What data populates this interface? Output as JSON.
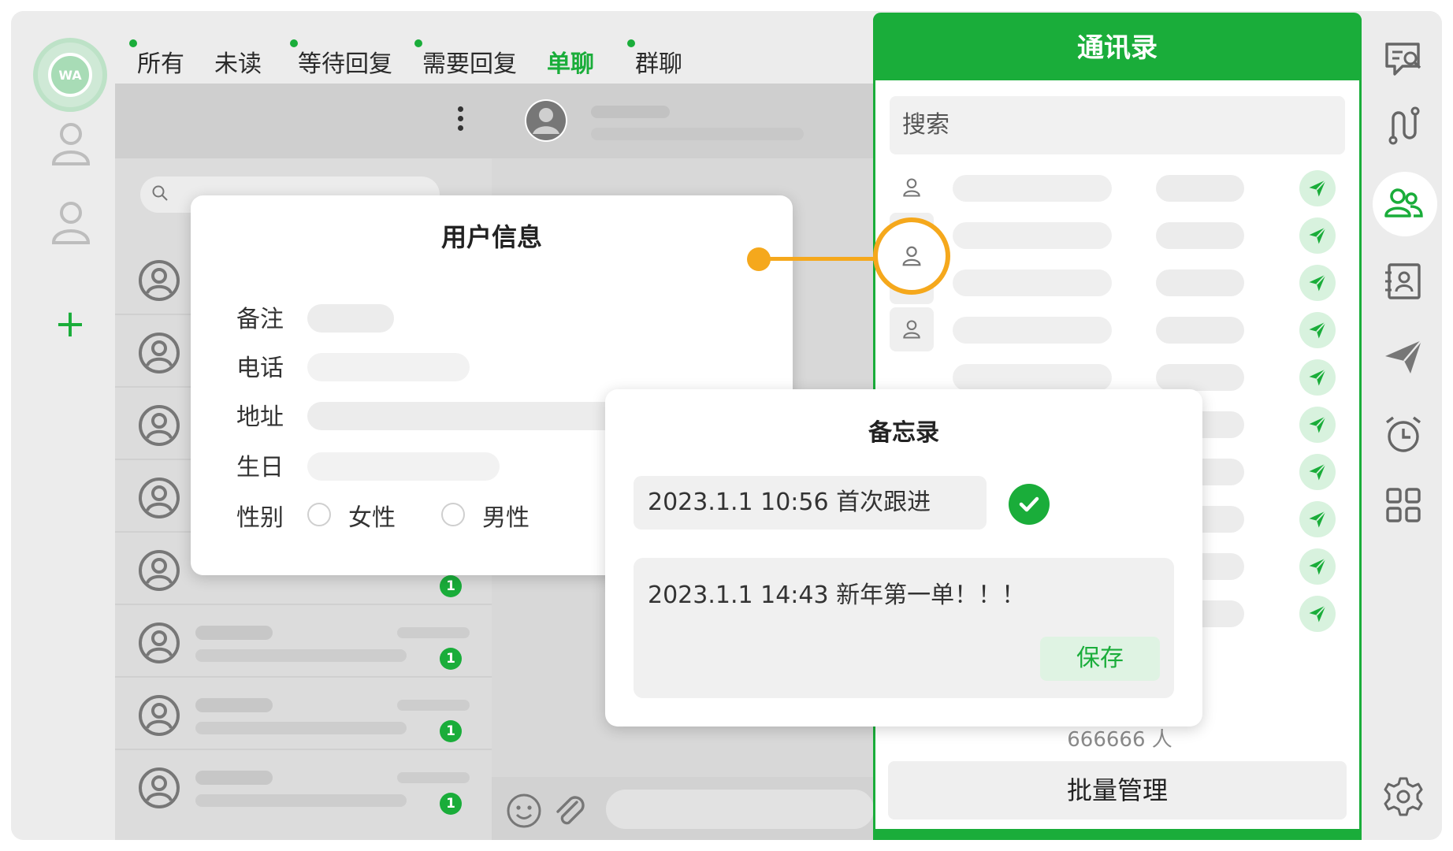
{
  "tabs": [
    {
      "label": "所有",
      "dot": true,
      "active": false
    },
    {
      "label": "未读",
      "dot": false,
      "active": false
    },
    {
      "label": "等待回复",
      "dot": true,
      "active": false
    },
    {
      "label": "需要回复",
      "dot": true,
      "active": false
    },
    {
      "label": "单聊",
      "dot": false,
      "active": true
    },
    {
      "label": "群聊",
      "dot": true,
      "active": false
    }
  ],
  "chat_list": {
    "rows_with_badge": [
      {
        "badge": "1"
      },
      {
        "badge": "1"
      },
      {
        "badge": "1"
      },
      {
        "badge": "1"
      }
    ]
  },
  "logo": {
    "text": "WA"
  },
  "contacts_panel": {
    "title": "通讯录",
    "search_placeholder": "搜索",
    "count": "666666 人",
    "batch_label": "批量管理"
  },
  "user_info": {
    "title": "用户信息",
    "labels": {
      "remark": "备注",
      "phone": "电话",
      "address": "地址",
      "birthday": "生日",
      "gender": "性别"
    },
    "gender_options": {
      "female": "女性",
      "male": "男性"
    }
  },
  "memo": {
    "title": "备忘录",
    "entry_1": "2023.1.1   10:56  首次跟进",
    "entry_2": "2023.1.1   14:43  新年第一单！！！",
    "save_label": "保存"
  },
  "colors": {
    "accent": "#1aad3a",
    "highlight": "#f5a81c"
  },
  "icons": [
    "user-icon",
    "plus-icon",
    "search-icon",
    "more-vertical-icon",
    "avatar-icon",
    "emoji-icon",
    "paperclip-icon",
    "send-icon",
    "check-icon",
    "chat-search-icon",
    "route-icon",
    "contacts-icon",
    "contact-card-icon",
    "broadcast-icon",
    "alarm-icon",
    "grid-icon",
    "settings-icon"
  ]
}
